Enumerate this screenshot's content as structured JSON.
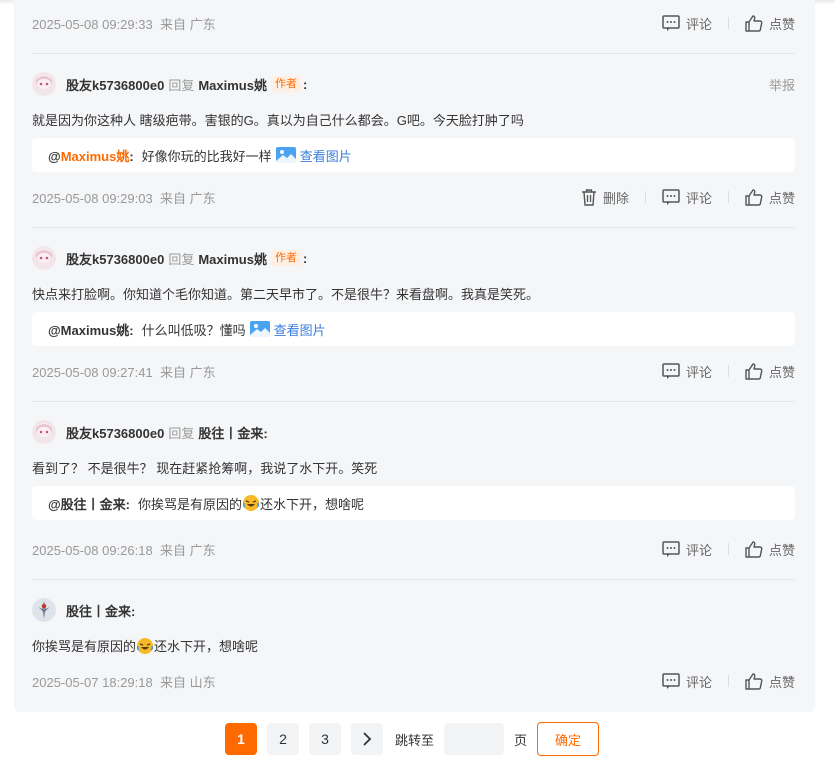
{
  "first_footer": {
    "time": "2025-05-08 09:29:33",
    "location": "来自 广东",
    "comment_label": "评论",
    "like_label": "点赞"
  },
  "comments": [
    {
      "user": "股友k5736800e0",
      "reply_word": "回复",
      "target": "Maximus姚",
      "author_tag": "作者",
      "colon": ":",
      "report": "举报",
      "text": "就是因为你这种人 瞎级疤带。害银的G。真以为自己什么都会。G吧。今天脸打肿了吗",
      "quote_prefix": "@",
      "quote_name": "Maximus姚",
      "quote_colon": ":",
      "quote_text": "好像你玩的比我好一样",
      "quote_link": "查看图片",
      "time": "2025-05-08 09:29:03",
      "location": "来自 广东",
      "delete_label": "删除",
      "comment_label": "评论",
      "like_label": "点赞"
    },
    {
      "user": "股友k5736800e0",
      "reply_word": "回复",
      "target": "Maximus姚",
      "author_tag": "作者",
      "colon": ":",
      "text": "快点来打脸啊。你知道个毛你知道。第二天早市了。不是很牛？来看盘啊。我真是笑死。",
      "quote_name": "@Maximus姚:",
      "quote_text": "什么叫低吸？懂吗",
      "quote_link": "查看图片",
      "time": "2025-05-08 09:27:41",
      "location": "来自 广东",
      "comment_label": "评论",
      "like_label": "点赞"
    },
    {
      "user": "股友k5736800e0",
      "reply_word": "回复",
      "target": "股往丨金来:",
      "text": "看到了？ 不是很牛？ 现在赶紧抢筹啊，我说了水下开。笑死",
      "quote_name": "@股往丨金来:",
      "quote_text_a": "你挨骂是有原因的",
      "quote_text_b": "还水下开，想啥呢",
      "time": "2025-05-08 09:26:18",
      "location": "来自 广东",
      "comment_label": "评论",
      "like_label": "点赞"
    },
    {
      "user": "股往丨金来:",
      "text_a": "你挨骂是有原因的",
      "text_b": "还水下开，想啥呢",
      "time": "2025-05-07 18:29:18",
      "location": "来自 山东",
      "comment_label": "评论",
      "like_label": "点赞"
    }
  ],
  "pagination": {
    "pages": [
      "1",
      "2",
      "3"
    ],
    "current": "1",
    "next_icon": "chevron-right-icon",
    "jump_label": "跳转至",
    "page_word": "页",
    "confirm_label": "确定"
  },
  "colors": {
    "accent": "#ff6a00",
    "link": "#3b7ddd",
    "panel_bg": "#f5f6f8"
  }
}
